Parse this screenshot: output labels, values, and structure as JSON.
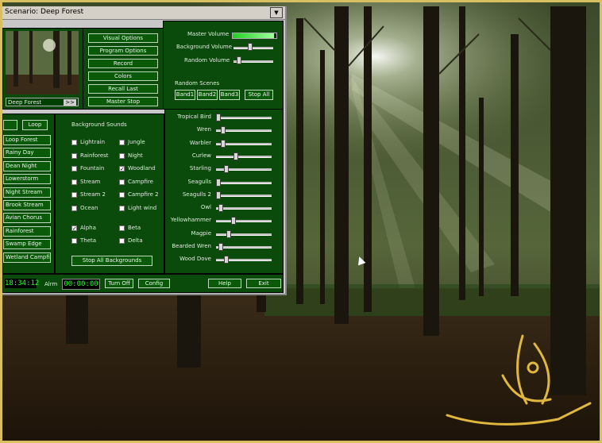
{
  "window": {
    "title": "Scenario: Deep Forest",
    "dropdown_icon": "triangle-down-icon"
  },
  "scenario": {
    "name": "Deep Forest",
    "select_arrow": ">>"
  },
  "main_buttons": [
    "Visual Options",
    "Program Options",
    "Record",
    "Colors",
    "Recall Last",
    "Master Stop"
  ],
  "master": {
    "label": "Master Volume",
    "level": 0.95
  },
  "bg_volume": {
    "label": "Background Volume",
    "level": 0.4
  },
  "random_volume": {
    "label": "Random Volume",
    "level": 0.1
  },
  "random_scenes": {
    "label": "Random Scenes",
    "buttons": [
      "Band1",
      "Band2",
      "Band3",
      "Stop All"
    ]
  },
  "left_top": [
    "",
    "Loop"
  ],
  "scenes": [
    "Loop Forest",
    "Rainy Day",
    "Dean Night",
    "Lowerstorm",
    "Night Stream",
    "Brook Stream",
    "Avian Chorus",
    "Rainforest",
    "Swamp Edge",
    "Wetland Campfire"
  ],
  "bg_sounds": {
    "label": "Background Sounds",
    "items": [
      {
        "name": "Lightrain",
        "checked": false
      },
      {
        "name": "Jungle",
        "checked": false
      },
      {
        "name": "Rainforest",
        "checked": false
      },
      {
        "name": "Night",
        "checked": false
      },
      {
        "name": "Fountain",
        "checked": false
      },
      {
        "name": "Woodland",
        "checked": true
      },
      {
        "name": "Stream",
        "checked": false
      },
      {
        "name": "Campfire",
        "checked": false
      },
      {
        "name": "Stream 2",
        "checked": false
      },
      {
        "name": "Campfire 2",
        "checked": false
      },
      {
        "name": "Ocean",
        "checked": false
      },
      {
        "name": "Light wind",
        "checked": false
      }
    ],
    "items2": [
      {
        "name": "Alpha",
        "checked": true
      },
      {
        "name": "Beta",
        "checked": false
      },
      {
        "name": "Theta",
        "checked": false
      },
      {
        "name": "Delta",
        "checked": false
      }
    ],
    "stop_all": "Stop All Backgrounds"
  },
  "birds": [
    {
      "name": "Tropical Bird",
      "level": 0.0
    },
    {
      "name": "Wren",
      "level": 0.1
    },
    {
      "name": "Warbler",
      "level": 0.1
    },
    {
      "name": "Curlew",
      "level": 0.35
    },
    {
      "name": "Starling",
      "level": 0.15
    },
    {
      "name": "Seagulls",
      "level": 0.0
    },
    {
      "name": "Seagulls 2",
      "level": 0.0
    },
    {
      "name": "Owl",
      "level": 0.05
    },
    {
      "name": "Yellowhammer",
      "level": 0.3
    },
    {
      "name": "Magpie",
      "level": 0.2
    },
    {
      "name": "Bearded Wren",
      "level": 0.05
    },
    {
      "name": "Wood Dove",
      "level": 0.15
    }
  ],
  "status": {
    "clock": "18:34:12",
    "alarm_label": "Alrm",
    "alarm_time": "00:00:00",
    "turn_off": "Turn Off",
    "config": "Config",
    "help": "Help",
    "exit": "Exit"
  },
  "colors": {
    "panel_green": "#0a4a0a",
    "lcd_green": "#22ff22",
    "frame_gold": "#d8c060"
  }
}
